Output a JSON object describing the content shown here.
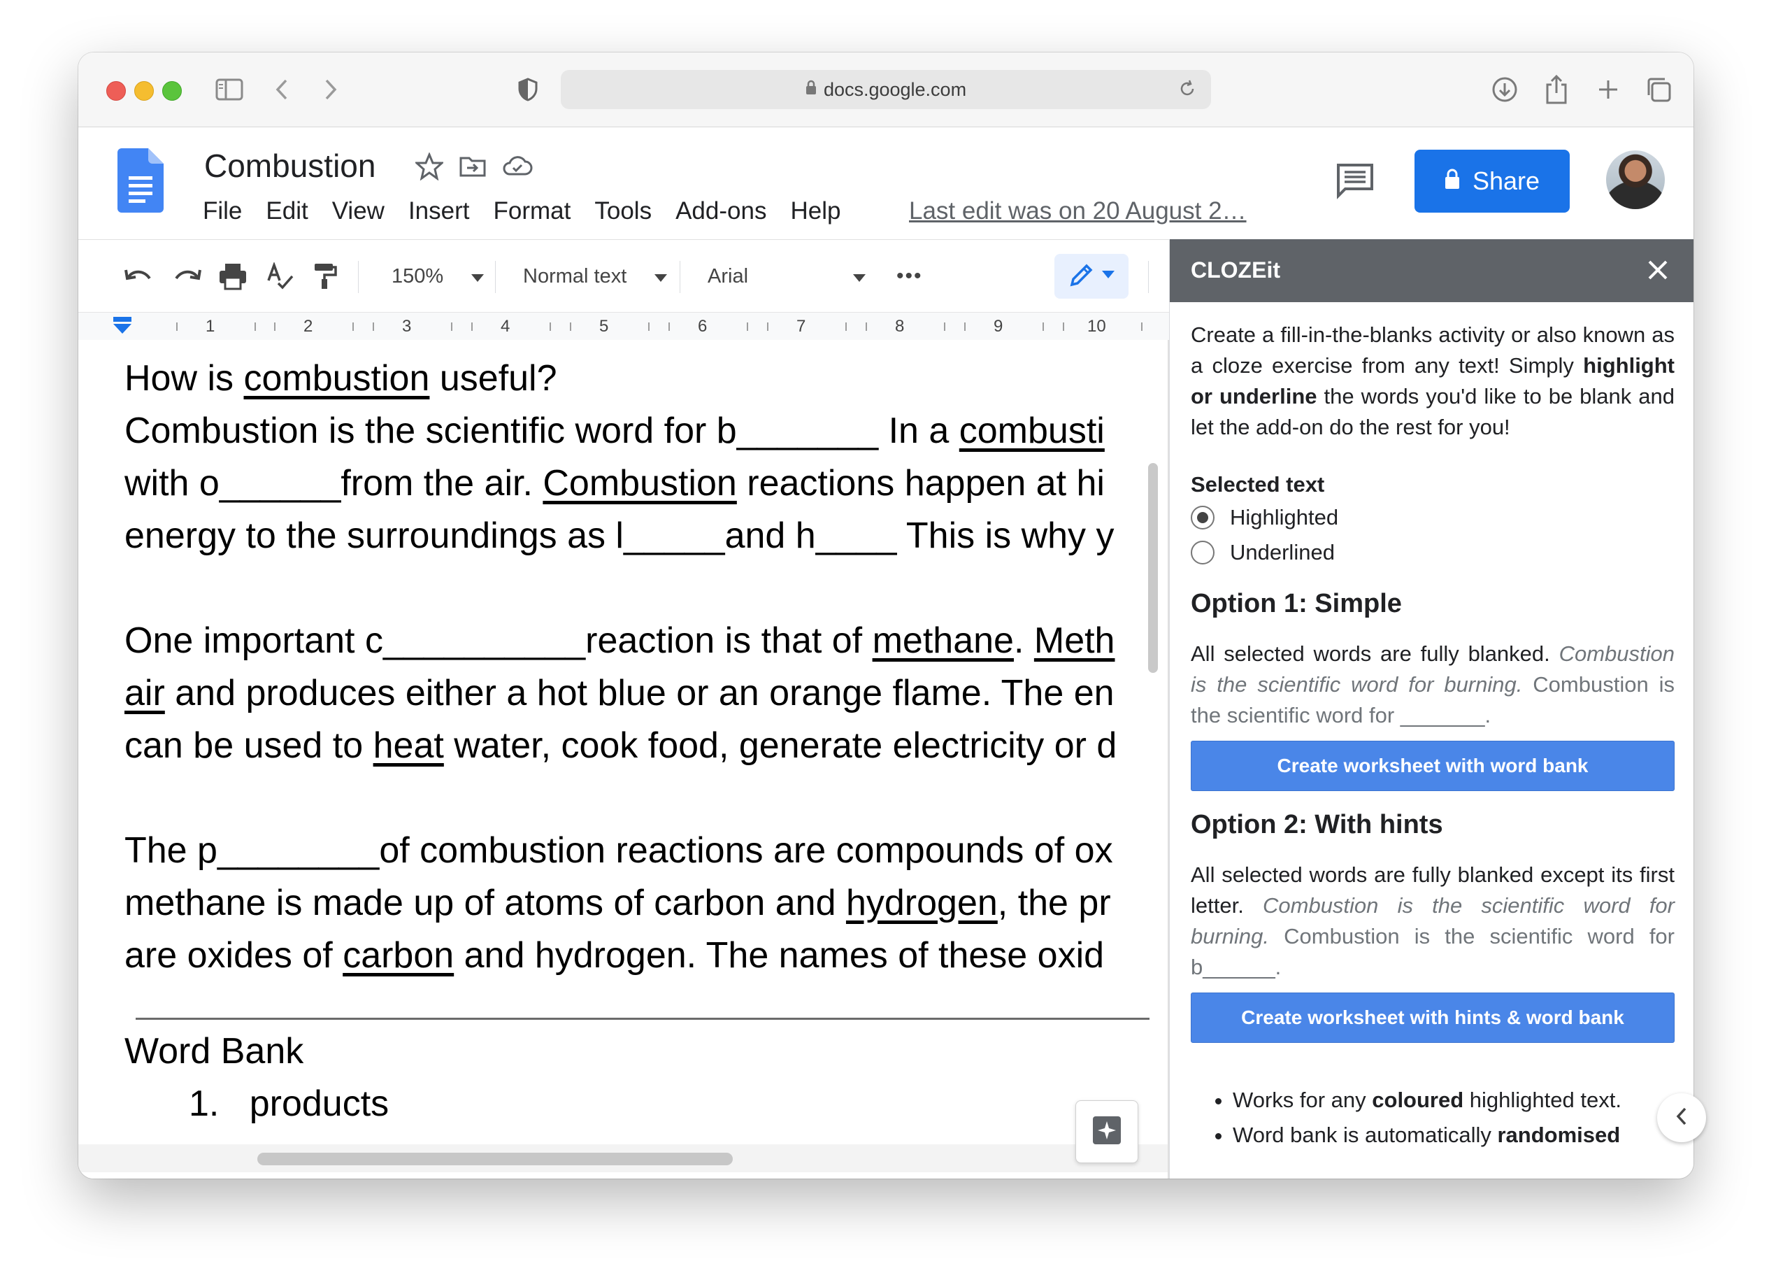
{
  "browser": {
    "url": "docs.google.com"
  },
  "doc": {
    "title": "Combustion",
    "menu": [
      "File",
      "Edit",
      "View",
      "Insert",
      "Format",
      "Tools",
      "Add-ons",
      "Help"
    ],
    "last_edit": "Last edit was on 20 August 2…",
    "share_label": "Share"
  },
  "toolbar": {
    "zoom": "150%",
    "style": "Normal text",
    "font": "Arial",
    "more": "•••"
  },
  "ruler": {
    "numbers": [
      "1",
      "2",
      "3",
      "4",
      "5",
      "6",
      "7",
      "8",
      "9",
      "10"
    ]
  },
  "body": {
    "p1_line1": {
      "a": "How is ",
      "u1": "combustion",
      "b": " useful?"
    },
    "p1_line2": {
      "a": "Combustion is the scientific word for b_______ In a ",
      "u1": "combusti"
    },
    "p1_line3": {
      "a": "with o______from the air. ",
      "u1": "Combustion",
      "b": " reactions happen at hi"
    },
    "p1_line4": {
      "a": "energy to the surroundings as l_____and h____ This is why y"
    },
    "p2_line1": {
      "a": "One important c__________reaction is that of ",
      "u1": "methane",
      "b": ". ",
      "u2": "Meth"
    },
    "p2_line2": {
      "u1": "air",
      "a": " and produces either a hot blue or an orange flame. The en"
    },
    "p2_line3": {
      "a": "can be used to ",
      "u1": "heat",
      "b": " water, cook food, generate electricity or d"
    },
    "p3_line1": {
      "a": "The p________of combustion reactions are compounds of ox"
    },
    "p3_line2": {
      "a": "methane is made up of atoms of carbon and ",
      "u1": "hydrogen",
      "b": ", the pr"
    },
    "p3_line3": {
      "a": "are oxides of ",
      "u1": "carbon",
      "b": " and hydrogen. The names of these oxid"
    },
    "word_bank_title": "Word Bank",
    "word_bank_item_num": "1.",
    "word_bank_item": "products"
  },
  "panel": {
    "title": "CLOZEit",
    "intro_a": "Create a fill-in-the-blanks activity or also known as a cloze exercise from any text! Simply ",
    "intro_bold": "highlight or underline",
    "intro_b": " the words you'd like to be blank and let the add-on do the rest for you!",
    "selected_text_label": "Selected text",
    "radio_highlighted": "Highlighted",
    "radio_underlined": "Underlined",
    "opt1_title": "Option 1: Simple",
    "opt1_desc": "All selected words are fully blanked. ",
    "opt1_example_italic": "Combustion is the scientific word for burning.",
    "opt1_example": " Combustion is the scientific word for _______.",
    "opt1_button": "Create worksheet with word bank",
    "opt2_title": "Option 2: With hints",
    "opt2_desc": "All selected words are fully blanked except its first letter. ",
    "opt2_example_italic": "Combustion is the scientific word for burning.",
    "opt2_example": " Combustion is the scientific word for b______.",
    "opt2_button": "Create worksheet with hints & word bank",
    "bullet1_a": "Works for any ",
    "bullet1_bold": "coloured",
    "bullet1_b": " highlighted text.",
    "bullet2_a": "Word bank is automatically ",
    "bullet2_bold": "randomised"
  },
  "colors": {
    "share": "#1a73e8",
    "panel_header": "#5f6368",
    "cta": "#4a86e8"
  },
  "icons": [
    "sidebar-icon",
    "back-icon",
    "forward-icon",
    "shield-icon",
    "lock-icon",
    "reload-icon",
    "download-icon",
    "share-sheet-icon",
    "new-tab-icon",
    "tabs-icon",
    "docs-logo-icon",
    "star-icon",
    "move-folder-icon",
    "cloud-status-icon",
    "comment-icon",
    "undo-icon",
    "redo-icon",
    "print-icon",
    "spellcheck-icon",
    "paint-format-icon",
    "pencil-icon",
    "close-icon",
    "explore-icon",
    "chevron-left-icon"
  ]
}
